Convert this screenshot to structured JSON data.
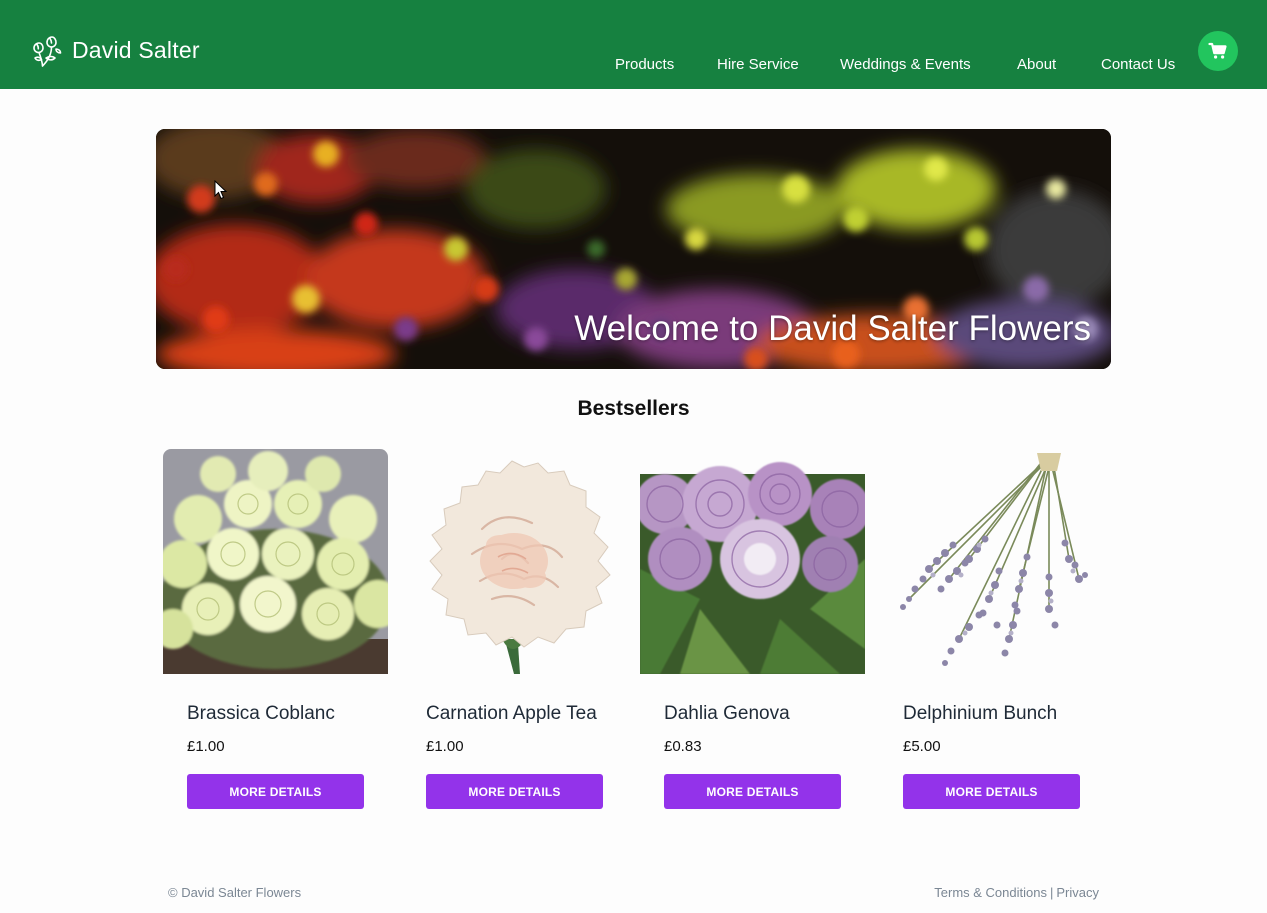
{
  "header": {
    "brand_name": "David Salter",
    "nav": [
      {
        "label": "Products"
      },
      {
        "label": "Hire Service"
      },
      {
        "label": "Weddings & Events"
      },
      {
        "label": "About"
      },
      {
        "label": "Contact Us"
      }
    ],
    "cart_icon": "shopping-cart-icon",
    "logo_icon": "flowers-icon"
  },
  "hero": {
    "title": "Welcome to David Salter Flowers"
  },
  "bestsellers": {
    "title": "Bestsellers",
    "products": [
      {
        "name": "Brassica Coblanc",
        "price": "£1.00",
        "button": "MORE DETAILS"
      },
      {
        "name": "Carnation Apple Tea",
        "price": "£1.00",
        "button": "MORE DETAILS"
      },
      {
        "name": "Dahlia Genova",
        "price": "£0.83",
        "button": "MORE DETAILS"
      },
      {
        "name": "Delphinium Bunch",
        "price": "£5.00",
        "button": "MORE DETAILS"
      }
    ]
  },
  "footer": {
    "copyright": "© David Salter Flowers",
    "terms": "Terms & Conditions",
    "separator": "|",
    "privacy": "Privacy"
  },
  "colors": {
    "header_green": "#168140",
    "cart_green": "#22c55e",
    "button_purple": "#9333ea"
  }
}
